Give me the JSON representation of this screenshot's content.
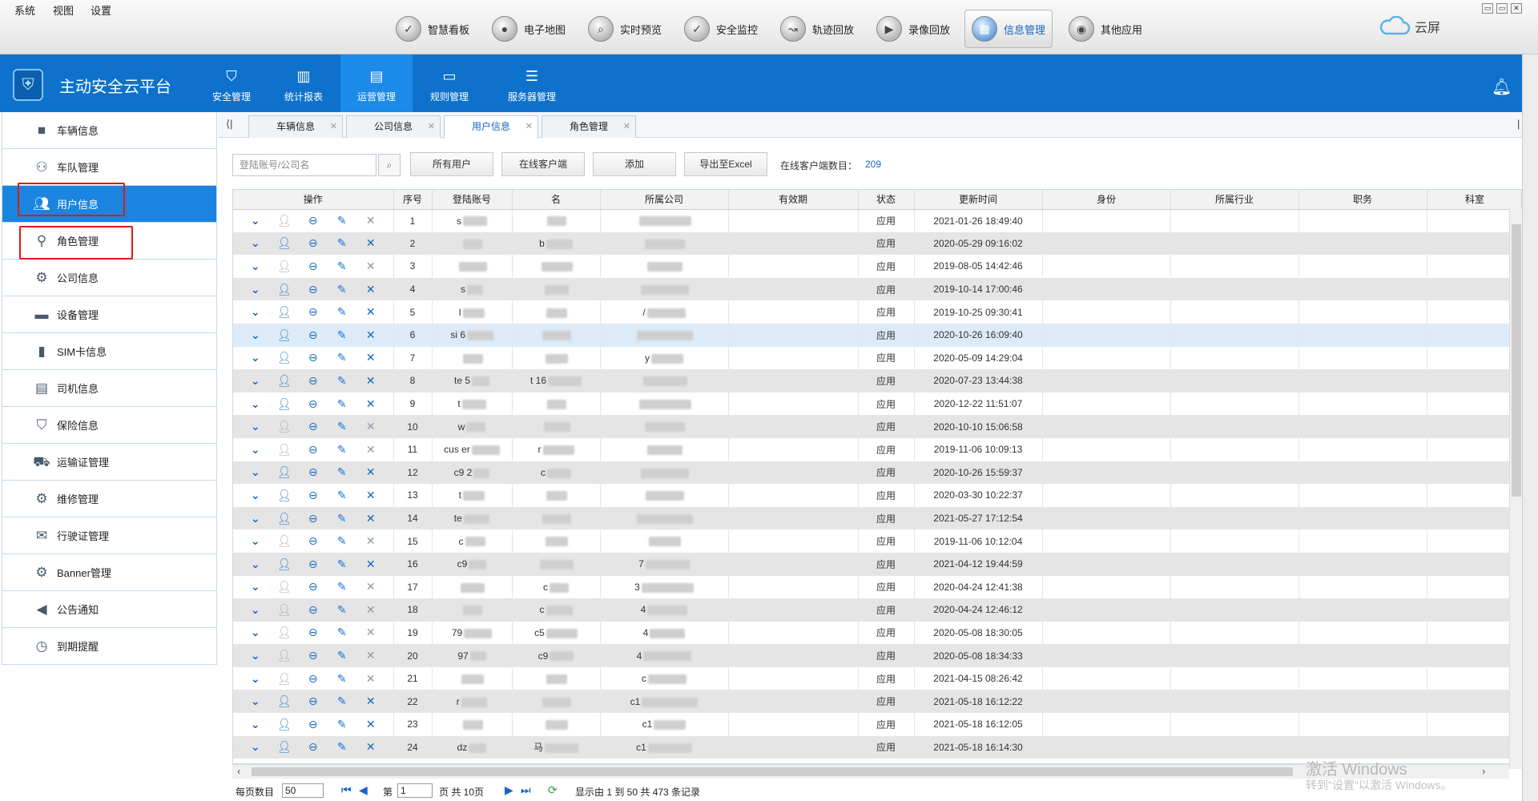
{
  "menubar": {
    "menus": [
      "系统",
      "视图",
      "设置"
    ],
    "apps": [
      {
        "label": "智慧看板",
        "icon": "shield-check-icon"
      },
      {
        "label": "电子地图",
        "icon": "map-pin-icon"
      },
      {
        "label": "实时预览",
        "icon": "search-icon"
      },
      {
        "label": "安全监控",
        "icon": "shield-check-icon"
      },
      {
        "label": "轨迹回放",
        "icon": "route-icon"
      },
      {
        "label": "录像回放",
        "icon": "video-icon"
      },
      {
        "label": "信息管理",
        "icon": "grid-icon",
        "active": true
      },
      {
        "label": "其他应用",
        "icon": "apps-icon"
      }
    ],
    "cloud_label": "云屏"
  },
  "header": {
    "title": "主动安全云平台",
    "tabs": [
      {
        "label": "安全管理",
        "icon": "shield-icon"
      },
      {
        "label": "统计报表",
        "icon": "bar-chart-icon"
      },
      {
        "label": "运营管理",
        "icon": "clipboard-icon",
        "active": true
      },
      {
        "label": "规则管理",
        "icon": "window-icon"
      },
      {
        "label": "服务器管理",
        "icon": "sliders-icon"
      }
    ]
  },
  "sidebar": {
    "items": [
      {
        "label": "车辆信息",
        "icon": "bus-icon"
      },
      {
        "label": "车队管理",
        "icon": "fleet-icon"
      },
      {
        "label": "用户信息",
        "icon": "users-icon",
        "active": true
      },
      {
        "label": "角色管理",
        "icon": "key-icon"
      },
      {
        "label": "公司信息",
        "icon": "gear-icon"
      },
      {
        "label": "设备管理",
        "icon": "device-icon"
      },
      {
        "label": "SIM卡信息",
        "icon": "sim-card-icon"
      },
      {
        "label": "司机信息",
        "icon": "id-card-icon"
      },
      {
        "label": "保险信息",
        "icon": "shield-icon"
      },
      {
        "label": "运输证管理",
        "icon": "truck-icon"
      },
      {
        "label": "维修管理",
        "icon": "wrench-gear-icon"
      },
      {
        "label": "行驶证管理",
        "icon": "envelope-icon"
      },
      {
        "label": "Banner管理",
        "icon": "gear-icon"
      },
      {
        "label": "公告通知",
        "icon": "speaker-icon"
      },
      {
        "label": "到期提醒",
        "icon": "clock-icon"
      }
    ]
  },
  "page_tabs": [
    {
      "label": "车辆信息"
    },
    {
      "label": "公司信息"
    },
    {
      "label": "用户信息",
      "active": true
    },
    {
      "label": "角色管理"
    }
  ],
  "toolbar": {
    "search_placeholder": "登陆账号/公司名",
    "all_users": "所有用户",
    "online_clients": "在线客户端",
    "add": "添加",
    "export": "导出至Excel",
    "online_count_label": "在线客户端数目：",
    "online_count": "209"
  },
  "table": {
    "columns": [
      "操作",
      "序号",
      "登陆账号",
      "名",
      "所属公司",
      "有效期",
      "状态",
      "更新时间",
      "身份",
      "所属行业",
      "职务",
      "科室"
    ],
    "rows": [
      {
        "no": "1",
        "account": "s",
        "name": "",
        "company": "",
        "status": "应用",
        "updated": "2021-01-26 18:49:40"
      },
      {
        "no": "2",
        "account": "",
        "name": "b",
        "company": "",
        "status": "应用",
        "updated": "2020-05-29 09:16:02"
      },
      {
        "no": "3",
        "account": "",
        "name": "",
        "company": "",
        "status": "应用",
        "updated": "2019-08-05 14:42:46"
      },
      {
        "no": "4",
        "account": "s",
        "name": "",
        "company": "",
        "status": "应用",
        "updated": "2019-10-14 17:00:46"
      },
      {
        "no": "5",
        "account": "l",
        "name": "",
        "company": "/",
        "status": "应用",
        "updated": "2019-10-25 09:30:41"
      },
      {
        "no": "6",
        "account": "si 6",
        "name": "",
        "company": "",
        "status": "应用",
        "updated": "2020-10-26 16:09:40"
      },
      {
        "no": "7",
        "account": "",
        "name": "",
        "company": "y",
        "status": "应用",
        "updated": "2020-05-09 14:29:04"
      },
      {
        "no": "8",
        "account": "te 5",
        "name": "t 16",
        "company": "",
        "status": "应用",
        "updated": "2020-07-23 13:44:38"
      },
      {
        "no": "9",
        "account": "t",
        "name": "",
        "company": "",
        "status": "应用",
        "updated": "2020-12-22 11:51:07"
      },
      {
        "no": "10",
        "account": "w",
        "name": "",
        "company": "",
        "status": "应用",
        "updated": "2020-10-10 15:06:58"
      },
      {
        "no": "11",
        "account": "cus er",
        "name": "r",
        "company": "",
        "status": "应用",
        "updated": "2019-11-06 10:09:13"
      },
      {
        "no": "12",
        "account": "c9 2",
        "name": "c",
        "company": "",
        "status": "应用",
        "updated": "2020-10-26 15:59:37"
      },
      {
        "no": "13",
        "account": "t",
        "name": "",
        "company": "",
        "status": "应用",
        "updated": "2020-03-30 10:22:37"
      },
      {
        "no": "14",
        "account": "te",
        "name": "",
        "company": "",
        "status": "应用",
        "updated": "2021-05-27 17:12:54"
      },
      {
        "no": "15",
        "account": "c",
        "name": "",
        "company": "",
        "status": "应用",
        "updated": "2019-11-06 10:12:04"
      },
      {
        "no": "16",
        "account": "c9",
        "name": "",
        "company": "7",
        "status": "应用",
        "updated": "2021-04-12 19:44:59"
      },
      {
        "no": "17",
        "account": "",
        "name": "c",
        "company": "3",
        "status": "应用",
        "updated": "2020-04-24 12:41:38"
      },
      {
        "no": "18",
        "account": "",
        "name": "c",
        "company": "4",
        "status": "应用",
        "updated": "2020-04-24 12:46:12"
      },
      {
        "no": "19",
        "account": "79",
        "name": "c5",
        "company": "4",
        "status": "应用",
        "updated": "2020-05-08 18:30:05"
      },
      {
        "no": "20",
        "account": "97",
        "name": "c9",
        "company": "4",
        "status": "应用",
        "updated": "2020-05-08 18:34:33"
      },
      {
        "no": "21",
        "account": "",
        "name": "",
        "company": "c",
        "status": "应用",
        "updated": "2021-04-15 08:26:42"
      },
      {
        "no": "22",
        "account": "r",
        "name": "",
        "company": "c1",
        "status": "应用",
        "updated": "2021-05-18 16:12:22"
      },
      {
        "no": "23",
        "account": "",
        "name": "",
        "company": "c1",
        "status": "应用",
        "updated": "2021-05-18 16:12:05"
      },
      {
        "no": "24",
        "account": "dz",
        "name": "马",
        "company": "c1",
        "status": "应用",
        "updated": "2021-05-18 16:14:30"
      }
    ]
  },
  "pager": {
    "page_size_label": "每页数目",
    "page_size": "50",
    "page_prefix": "第",
    "page_value": "1",
    "page_suffix": "页 共 10页",
    "summary": "显示由 1 到 50 共 473 条记录"
  },
  "watermark": {
    "line1": "激活 Windows",
    "line2": "转到\"设置\"以激活 Windows。"
  },
  "colors": {
    "brand_blue": "#0e72cc",
    "active_blue": "#1b84e0",
    "highlight_red": "#e01818"
  }
}
